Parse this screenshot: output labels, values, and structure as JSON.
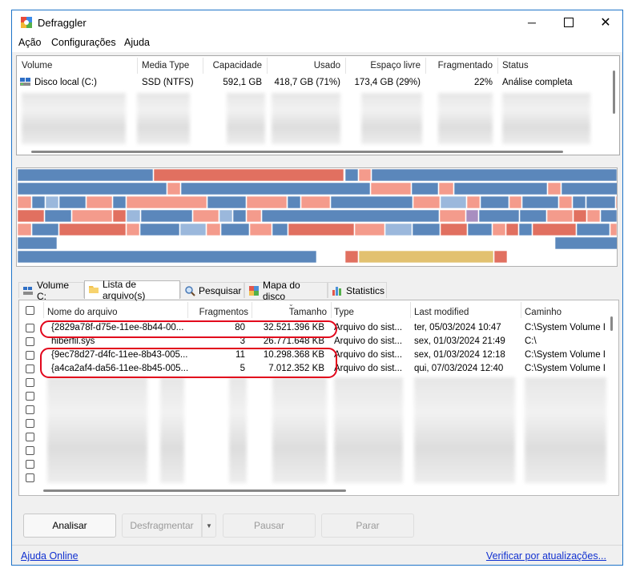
{
  "window": {
    "title": "Defraggler"
  },
  "menu": [
    "Ação",
    "Configurações",
    "Ajuda"
  ],
  "drives": {
    "columns": [
      "Volume",
      "Media Type",
      "Capacidade",
      "Usado",
      "Espaço livre",
      "Fragmentado",
      "Status"
    ],
    "rows": [
      {
        "volume": "Disco local (C:)",
        "media": "SSD (NTFS)",
        "capacity": "592,1 GB",
        "used": "418,7 GB (71%)",
        "free": "173,4 GB (29%)",
        "fragmented": "22%",
        "status": "Análise completa"
      }
    ]
  },
  "disk_map": {
    "colors": {
      "blue": "#5b87bb",
      "red": "#e17060",
      "light_red": "#f49b8c",
      "light_blue": "#9bb8dc",
      "tan": "#e2c170",
      "purple": "#a88ec0",
      "white": "#ffffff"
    }
  },
  "tabs": [
    "Volume C:",
    "Lista de arquivo(s)",
    "Pesquisar",
    "Mapa do disco",
    "Statistics"
  ],
  "active_tab": "Lista de arquivo(s)",
  "files": {
    "columns": [
      "Nome do arquivo",
      "Fragmentos",
      "Tamanho",
      "Type",
      "Last modified",
      "Caminho"
    ],
    "rows": [
      {
        "name": "{2829a78f-d75e-11ee-8b44-00...",
        "fragments": "80",
        "size": "32.521.396 KB",
        "type": "Arquivo do sist...",
        "modified": "ter, 05/03/2024 10:47",
        "path": "C:\\System Volume Ir"
      },
      {
        "name": "hiberfil.sys",
        "fragments": "3",
        "size": "26.771.648 KB",
        "type": "Arquivo do sist...",
        "modified": "sex, 01/03/2024 21:49",
        "path": "C:\\"
      },
      {
        "name": "{9ec78d27-d4fc-11ee-8b43-005...",
        "fragments": "11",
        "size": "10.298.368 KB",
        "type": "Arquivo do sist...",
        "modified": "sex, 01/03/2024 12:18",
        "path": "C:\\System Volume Ir"
      },
      {
        "name": "{a4ca2af4-da56-11ee-8b45-005...",
        "fragments": "5",
        "size": "7.012.352 KB",
        "type": "Arquivo do sist...",
        "modified": "qui, 07/03/2024 12:40",
        "path": "C:\\System Volume Ir"
      }
    ]
  },
  "buttons": {
    "analyze": "Analisar",
    "defrag": "Desfragmentar",
    "pause": "Pausar",
    "stop": "Parar"
  },
  "footer": {
    "help": "Ajuda Online",
    "updates": "Verificar por atualizações..."
  }
}
